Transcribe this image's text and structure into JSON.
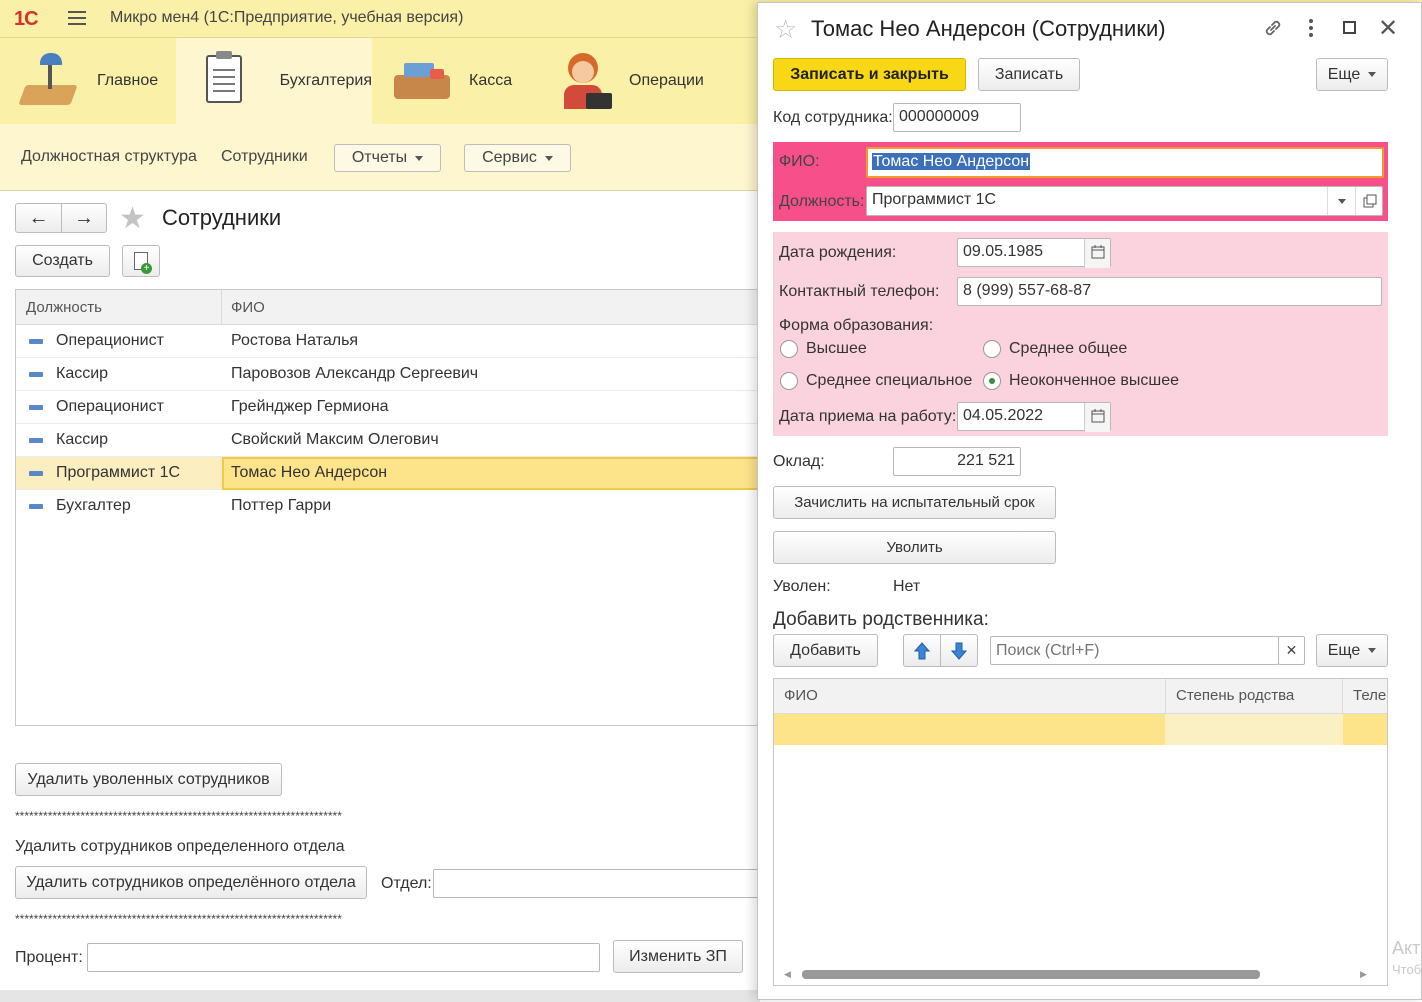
{
  "app": {
    "logo": "1С",
    "title": "Микро мен4  (1С:Предприятие, учебная версия)"
  },
  "sections": [
    {
      "label": "Главное",
      "icon": "desk-lamp-icon"
    },
    {
      "label": "Бухгалтерия",
      "icon": "clipboard-icon"
    },
    {
      "label": "Касса",
      "icon": "cash-register-icon"
    },
    {
      "label": "Операции",
      "icon": "operator-woman-icon"
    }
  ],
  "subnav": {
    "links": [
      "Должностная структура",
      "Сотрудники"
    ],
    "reports": "Отчеты",
    "service": "Сервис"
  },
  "list_page": {
    "title": "Сотрудники",
    "create": "Создать",
    "columns": [
      "Должность",
      "ФИО"
    ],
    "rows": [
      {
        "position": "Операционист",
        "name": "Ростова Наталья"
      },
      {
        "position": "Кассир",
        "name": "Паровозов Александр Сергеевич"
      },
      {
        "position": "Операционист",
        "name": "Грейнджер Гермиона"
      },
      {
        "position": "Кассир",
        "name": "Свойский Максим Олегович"
      },
      {
        "position": "Программист 1С",
        "name": "Томас Нео Андерсон"
      },
      {
        "position": "Бухгалтер",
        "name": "Поттер Гарри"
      }
    ],
    "delete_fired": "Удалить уволенных сотрудников",
    "stars": "**********************************************************************",
    "dept_heading": "Удалить сотрудников определенного отдела",
    "delete_dept": "Удалить сотрудников определённого отдела",
    "dept_label": "Отдел:",
    "percent_label": "Процент:",
    "change_salary": "Изменить ЗП"
  },
  "form": {
    "title": "Томас Нео Андерсон (Сотрудники)",
    "save_close": "Записать и закрыть",
    "save": "Записать",
    "more": "Еще",
    "code_label": "Код сотрудника:",
    "code": "000000009",
    "fio_label": "ФИО:",
    "fio": "Томас Нео Андерсон",
    "position_label": "Должность:",
    "position": "Программист 1С",
    "birth_label": "Дата рождения:",
    "birth": "09.05.1985",
    "phone_label": "Контактный телефон:",
    "phone": "8 (999) 557-68-87",
    "education_label": "Форма образования:",
    "education_options": [
      "Высшее",
      "Среднее общее",
      "Среднее специальное",
      "Неоконченное высшее"
    ],
    "education_selected": "Неоконченное высшее",
    "hire_label": "Дата приема на работу:",
    "hire": "04.05.2022",
    "salary_label": "Оклад:",
    "salary": "221 521",
    "probation": "Зачислить на испытательный срок",
    "fire": "Уволить",
    "fired_label": "Уволен:",
    "fired": "Нет",
    "relatives_heading": "Добавить родственника:",
    "add": "Добавить",
    "search_placeholder": "Поиск (Ctrl+F)",
    "rel_columns": [
      "ФИО",
      "Степень родства",
      "Теле"
    ]
  },
  "watermark": [
    "Акт",
    "Чтоб"
  ]
}
